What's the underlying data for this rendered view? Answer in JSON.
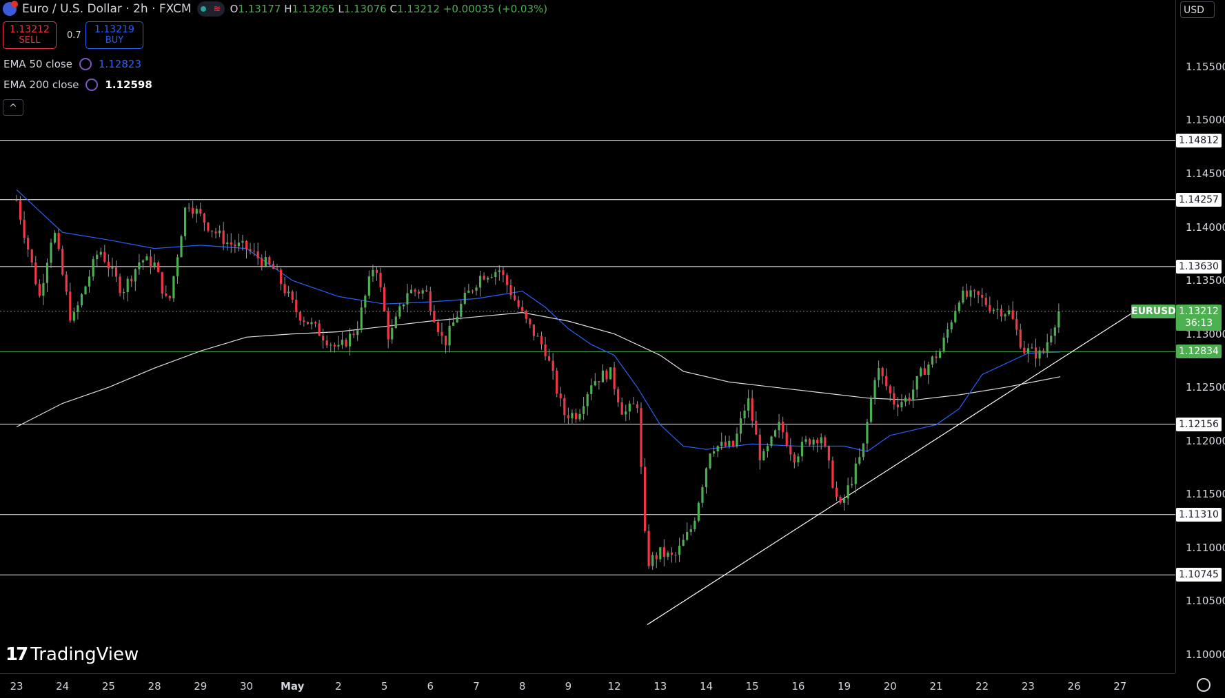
{
  "header": {
    "symbol_title": "Euro / U.S. Dollar · 2h · FXCM",
    "ohlc": {
      "open_label": "O",
      "open": "1.13177",
      "high_label": "H",
      "high": "1.13265",
      "low_label": "L",
      "low": "1.13076",
      "close_label": "C",
      "close": "1.13212",
      "change": "+0.00035 (+0.03%)"
    }
  },
  "trade": {
    "sell_price": "1.13212",
    "sell_label": "SELL",
    "spread": "0.7",
    "buy_price": "1.13219",
    "buy_label": "BUY"
  },
  "indicators": [
    {
      "label": "EMA 50 close",
      "value": "1.12823",
      "color": "#2962ff"
    },
    {
      "label": "EMA 200 close",
      "value": "1.12598",
      "color": "#ffffff"
    }
  ],
  "collapse_glyph": "^",
  "currency": "USD",
  "logo_text": "TradingView",
  "last_price": {
    "symbol": "EURUSD",
    "price": "1.13212",
    "countdown": "36:13"
  },
  "price_axis": {
    "ticks": [
      "1.15500",
      "1.15000",
      "1.14500",
      "1.14000",
      "1.13500",
      "1.13000",
      "1.12500",
      "1.12000",
      "1.11500",
      "1.11000",
      "1.10500",
      "1.10000"
    ],
    "ylim": [
      1.09825,
      1.16125
    ]
  },
  "horizontal_levels": [
    {
      "price": 1.14812,
      "label": "1.14812",
      "color": "#ffffff"
    },
    {
      "price": 1.14257,
      "label": "1.14257",
      "color": "#ffffff"
    },
    {
      "price": 1.1363,
      "label": "1.13630",
      "color": "#ffffff"
    },
    {
      "price": 1.12834,
      "label": "1.12834",
      "color": "#4caf50"
    },
    {
      "price": 1.12156,
      "label": "1.12156",
      "color": "#ffffff"
    },
    {
      "price": 1.1131,
      "label": "1.11310",
      "color": "#ffffff"
    },
    {
      "price": 1.10745,
      "label": "1.10745",
      "color": "#ffffff"
    }
  ],
  "time_axis": {
    "labels": [
      "23",
      "24",
      "25",
      "28",
      "29",
      "30",
      "May",
      "2",
      "5",
      "6",
      "7",
      "8",
      "9",
      "12",
      "13",
      "14",
      "15",
      "16",
      "19",
      "20",
      "21",
      "22",
      "23",
      "26",
      "27"
    ]
  },
  "colors": {
    "up": "#4caf50",
    "down": "#f23645",
    "ema50": "#2962ff",
    "ema200": "#e0e0e0",
    "background": "#000000"
  },
  "chart_data": {
    "type": "candlestick",
    "title": "Euro / U.S. Dollar · 2h · FXCM",
    "x_dates": [
      "23",
      "24",
      "25",
      "28",
      "29",
      "30",
      "May",
      "2",
      "5",
      "6",
      "7",
      "8",
      "9",
      "12",
      "13",
      "14",
      "15",
      "16",
      "19",
      "20",
      "21",
      "22",
      "23",
      "26",
      "27"
    ],
    "ylim": [
      1.09825,
      1.16125
    ],
    "waypoints": [
      {
        "day": 0.0,
        "price": 1.1425
      },
      {
        "day": 0.5,
        "price": 1.1335
      },
      {
        "day": 0.8,
        "price": 1.14
      },
      {
        "day": 1.2,
        "price": 1.131
      },
      {
        "day": 1.8,
        "price": 1.138
      },
      {
        "day": 2.3,
        "price": 1.134
      },
      {
        "day": 2.7,
        "price": 1.137
      },
      {
        "day": 3.0,
        "price": 1.1365
      },
      {
        "day": 3.3,
        "price": 1.1325
      },
      {
        "day": 3.7,
        "price": 1.1425
      },
      {
        "day": 4.2,
        "price": 1.14
      },
      {
        "day": 4.6,
        "price": 1.1385
      },
      {
        "day": 5.0,
        "price": 1.138
      },
      {
        "day": 5.6,
        "price": 1.136
      },
      {
        "day": 6.1,
        "price": 1.132
      },
      {
        "day": 6.5,
        "price": 1.1305
      },
      {
        "day": 7.0,
        "price": 1.1285
      },
      {
        "day": 7.4,
        "price": 1.1305
      },
      {
        "day": 7.8,
        "price": 1.137
      },
      {
        "day": 8.1,
        "price": 1.1295
      },
      {
        "day": 8.5,
        "price": 1.134
      },
      {
        "day": 8.9,
        "price": 1.134
      },
      {
        "day": 9.3,
        "price": 1.129
      },
      {
        "day": 9.7,
        "price": 1.133
      },
      {
        "day": 10.1,
        "price": 1.1355
      },
      {
        "day": 10.5,
        "price": 1.136
      },
      {
        "day": 10.8,
        "price": 1.1335
      },
      {
        "day": 11.1,
        "price": 1.131
      },
      {
        "day": 11.5,
        "price": 1.1285
      },
      {
        "day": 11.9,
        "price": 1.1225
      },
      {
        "day": 12.2,
        "price": 1.1225
      },
      {
        "day": 12.5,
        "price": 1.1255
      },
      {
        "day": 12.9,
        "price": 1.1265
      },
      {
        "day": 13.2,
        "price": 1.1225
      },
      {
        "day": 13.5,
        "price": 1.1235
      },
      {
        "day": 13.7,
        "price": 1.1085
      },
      {
        "day": 14.0,
        "price": 1.1095
      },
      {
        "day": 14.3,
        "price": 1.109
      },
      {
        "day": 14.7,
        "price": 1.112
      },
      {
        "day": 15.1,
        "price": 1.1195
      },
      {
        "day": 15.6,
        "price": 1.1195
      },
      {
        "day": 15.9,
        "price": 1.124
      },
      {
        "day": 16.2,
        "price": 1.118
      },
      {
        "day": 16.6,
        "price": 1.1215
      },
      {
        "day": 16.9,
        "price": 1.1185
      },
      {
        "day": 17.2,
        "price": 1.12
      },
      {
        "day": 17.5,
        "price": 1.1205
      },
      {
        "day": 17.9,
        "price": 1.1135
      },
      {
        "day": 18.4,
        "price": 1.119
      },
      {
        "day": 18.7,
        "price": 1.127
      },
      {
        "day": 19.1,
        "price": 1.1235
      },
      {
        "day": 19.4,
        "price": 1.124
      },
      {
        "day": 19.7,
        "price": 1.1265
      },
      {
        "day": 20.1,
        "price": 1.1285
      },
      {
        "day": 20.5,
        "price": 1.1335
      },
      {
        "day": 20.9,
        "price": 1.1335
      },
      {
        "day": 21.2,
        "price": 1.1325
      },
      {
        "day": 21.6,
        "price": 1.132
      },
      {
        "day": 21.9,
        "price": 1.1285
      },
      {
        "day": 22.3,
        "price": 1.128
      },
      {
        "day": 22.7,
        "price": 1.1325
      }
    ],
    "ema50": [
      {
        "day": 0.0,
        "price": 1.1435
      },
      {
        "day": 1.0,
        "price": 1.1395
      },
      {
        "day": 2.0,
        "price": 1.1388
      },
      {
        "day": 3.0,
        "price": 1.138
      },
      {
        "day": 4.0,
        "price": 1.1383
      },
      {
        "day": 5.0,
        "price": 1.138
      },
      {
        "day": 6.0,
        "price": 1.135
      },
      {
        "day": 7.0,
        "price": 1.1335
      },
      {
        "day": 8.0,
        "price": 1.1328
      },
      {
        "day": 9.0,
        "price": 1.133
      },
      {
        "day": 10.0,
        "price": 1.1333
      },
      {
        "day": 11.0,
        "price": 1.134
      },
      {
        "day": 11.5,
        "price": 1.1325
      },
      {
        "day": 12.0,
        "price": 1.1305
      },
      {
        "day": 12.5,
        "price": 1.129
      },
      {
        "day": 13.0,
        "price": 1.128
      },
      {
        "day": 13.5,
        "price": 1.125
      },
      {
        "day": 14.0,
        "price": 1.1215
      },
      {
        "day": 14.5,
        "price": 1.1195
      },
      {
        "day": 15.0,
        "price": 1.1192
      },
      {
        "day": 16.0,
        "price": 1.1197
      },
      {
        "day": 17.0,
        "price": 1.1195
      },
      {
        "day": 18.0,
        "price": 1.1195
      },
      {
        "day": 18.5,
        "price": 1.119
      },
      {
        "day": 19.0,
        "price": 1.1205
      },
      {
        "day": 20.0,
        "price": 1.1215
      },
      {
        "day": 20.5,
        "price": 1.123
      },
      {
        "day": 21.0,
        "price": 1.1262
      },
      {
        "day": 22.0,
        "price": 1.1282
      },
      {
        "day": 22.7,
        "price": 1.1283
      }
    ],
    "ema200": [
      {
        "day": 0.0,
        "price": 1.1213
      },
      {
        "day": 1.0,
        "price": 1.1235
      },
      {
        "day": 2.0,
        "price": 1.125
      },
      {
        "day": 3.0,
        "price": 1.1268
      },
      {
        "day": 4.0,
        "price": 1.1284
      },
      {
        "day": 5.0,
        "price": 1.1297
      },
      {
        "day": 6.0,
        "price": 1.13
      },
      {
        "day": 7.0,
        "price": 1.1302
      },
      {
        "day": 8.0,
        "price": 1.1307
      },
      {
        "day": 9.0,
        "price": 1.1312
      },
      {
        "day": 10.0,
        "price": 1.1316
      },
      {
        "day": 11.0,
        "price": 1.132
      },
      {
        "day": 12.0,
        "price": 1.1312
      },
      {
        "day": 13.0,
        "price": 1.13
      },
      {
        "day": 14.0,
        "price": 1.128
      },
      {
        "day": 14.5,
        "price": 1.1265
      },
      {
        "day": 15.5,
        "price": 1.1255
      },
      {
        "day": 16.5,
        "price": 1.125
      },
      {
        "day": 17.5,
        "price": 1.1245
      },
      {
        "day": 18.5,
        "price": 1.124
      },
      {
        "day": 19.5,
        "price": 1.1238
      },
      {
        "day": 20.5,
        "price": 1.1243
      },
      {
        "day": 21.5,
        "price": 1.125
      },
      {
        "day": 22.7,
        "price": 1.126
      }
    ],
    "trendline": {
      "from": {
        "day": 13.72,
        "price": 1.1028
      },
      "to": {
        "day": 24.35,
        "price": 1.1322
      }
    }
  }
}
